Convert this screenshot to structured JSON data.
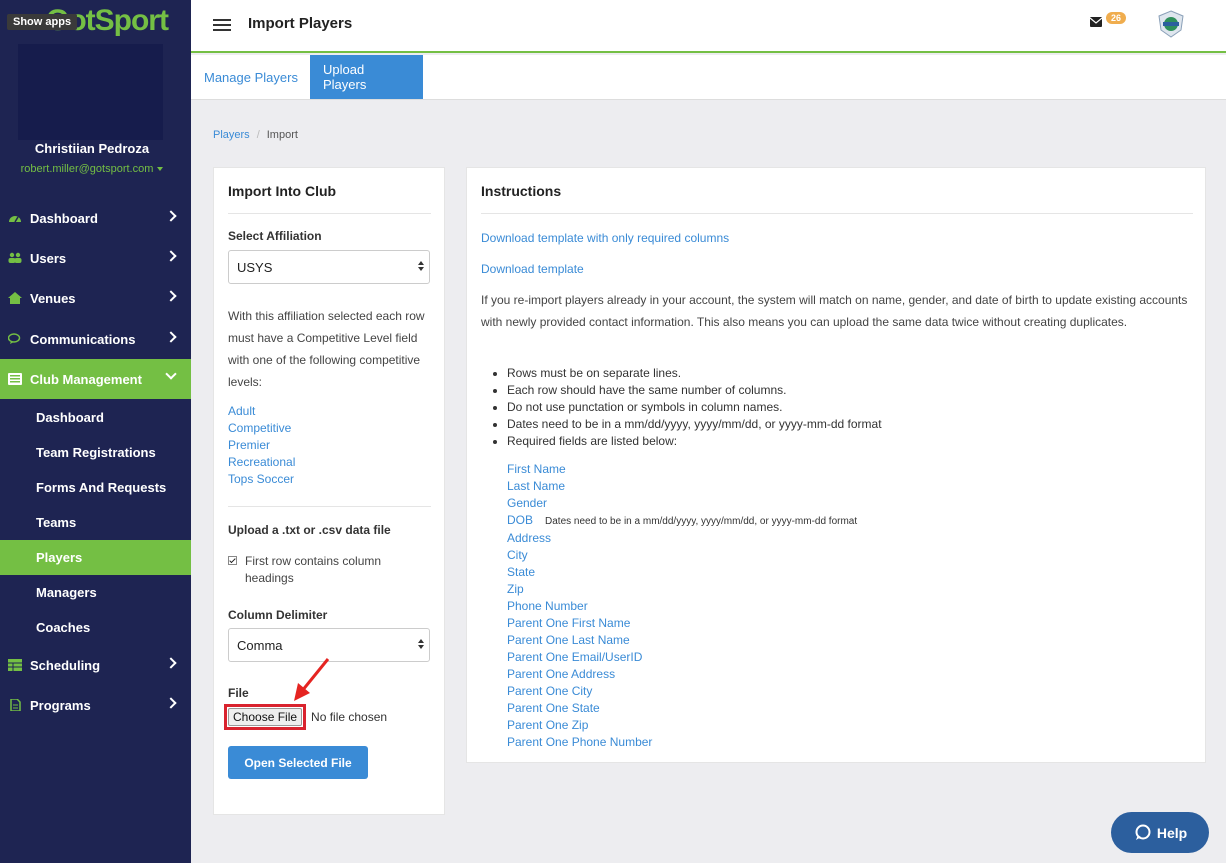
{
  "brand": {
    "logo_text": "GotSport",
    "show_apps": "Show apps"
  },
  "user": {
    "name": "Christiian Pedroza",
    "email": "robert.miller@gotsport.com"
  },
  "sidebar": {
    "items": [
      {
        "label": "Dashboard",
        "icon": "tachometer-icon"
      },
      {
        "label": "Users",
        "icon": "users-icon"
      },
      {
        "label": "Venues",
        "icon": "home-icon"
      },
      {
        "label": "Communications",
        "icon": "comments-icon"
      },
      {
        "label": "Club Management",
        "icon": "list-icon"
      },
      {
        "label": "Scheduling",
        "icon": "table-icon"
      },
      {
        "label": "Programs",
        "icon": "file-icon"
      }
    ],
    "sub_items": [
      "Dashboard",
      "Team Registrations",
      "Forms And Requests",
      "Teams",
      "Players",
      "Managers",
      "Coaches"
    ],
    "active_sub": "Players"
  },
  "header": {
    "title": "Import Players",
    "mail_count": "26"
  },
  "tabs": [
    {
      "label": "Manage Players"
    },
    {
      "label": "Upload Players"
    }
  ],
  "breadcrumb": {
    "parent": "Players",
    "separator": "/",
    "current": "Import"
  },
  "import_panel": {
    "title": "Import Into Club",
    "affiliation_label": "Select Affiliation",
    "affiliation_value": "USYS",
    "affiliation_note": "With this affiliation selected each row must have a Competitive Level field with one of the following competitive levels:",
    "levels": [
      "Adult",
      "Competitive",
      "Premier",
      "Recreational",
      "Tops Soccer"
    ],
    "upload_label": "Upload a .txt or .csv data file",
    "first_row_label": "First row contains column headings",
    "delimiter_label": "Column Delimiter",
    "delimiter_value": "Comma",
    "file_label": "File",
    "choose_file": "Choose File",
    "no_file": "No file chosen",
    "open_button": "Open Selected File"
  },
  "instructions": {
    "title": "Instructions",
    "link_required": "Download template with only required columns",
    "link_template": "Download template",
    "paragraph": "If you re-import players already in your account, the system will match on name, gender, and date of birth to update existing accounts with newly provided contact information. This also means you can upload the same data twice without creating duplicates.",
    "bullets": [
      "Rows must be on separate lines.",
      "Each row should have the same number of columns.",
      "Do not use punctation or symbols in column names.",
      "Dates need to be in a mm/dd/yyyy, yyyy/mm/dd, or yyyy-mm-dd format",
      "Required fields are listed below:"
    ],
    "fields": [
      "First Name",
      "Last Name",
      "Gender",
      "DOB",
      "Address",
      "City",
      "State",
      "Zip",
      "Phone Number",
      "Parent One First Name",
      "Parent One Last Name",
      "Parent One Email/UserID",
      "Parent One Address",
      "Parent One City",
      "Parent One State",
      "Parent One Zip",
      "Parent One Phone Number"
    ],
    "dob_note": "Dates need to be in a mm/dd/yyyy, yyyy/mm/dd, or yyyy-mm-dd format"
  },
  "help": {
    "label": "Help"
  },
  "colors": {
    "sidebar": "#1e2452",
    "accent_green": "#74bf44",
    "link_blue": "#3a8bd6",
    "highlight_red": "#d9232e"
  }
}
